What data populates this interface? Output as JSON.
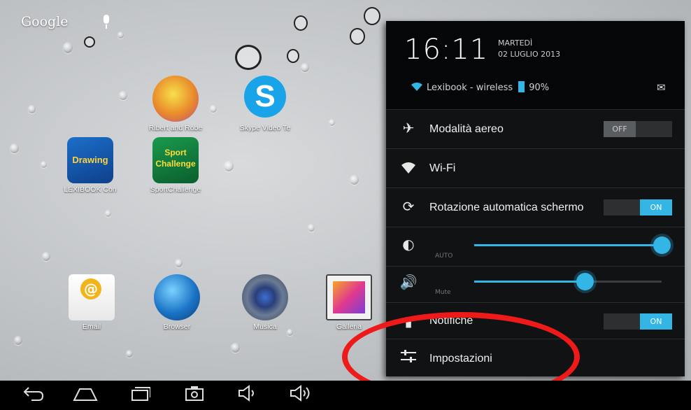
{
  "homescreen": {
    "search_label": "Google",
    "apps": [
      {
        "label": "Ribert and Robe",
        "icon": "robert-game-icon"
      },
      {
        "label": "Skype Video Te",
        "icon": "skype-icon",
        "glyph": "S"
      },
      {
        "label": "LEXIBOOK Con",
        "icon": "drawing-app-icon",
        "glyph": "Drawing"
      },
      {
        "label": "SportChallenge",
        "icon": "sport-challenge-icon",
        "glyph": "Sport Challenge"
      },
      {
        "label": "Email",
        "icon": "email-icon"
      },
      {
        "label": "Browser",
        "icon": "browser-globe-icon"
      },
      {
        "label": "Musica",
        "icon": "speaker-icon"
      },
      {
        "label": "Galleria",
        "icon": "gallery-icon"
      }
    ]
  },
  "navbar": {
    "buttons": [
      "back-icon",
      "home-icon",
      "recent-apps-icon",
      "screenshot-icon",
      "volume-down-icon",
      "volume-up-icon"
    ]
  },
  "panel": {
    "time": "16:11",
    "day": "MARTEDÌ",
    "date": "02 LUGLIO 2013",
    "network": "Lexibook - wireless",
    "battery": "90%",
    "rows": {
      "airplane": {
        "label": "Modalità aereo",
        "toggle": "OFF"
      },
      "wifi": {
        "label": "Wi-Fi"
      },
      "rotation": {
        "label": "Rotazione automatica schermo",
        "toggle": "ON"
      },
      "brightness": {
        "sublabel": "AUTO",
        "level": 1.0
      },
      "volume": {
        "sublabel": "Mute",
        "level": 0.59
      },
      "notifications": {
        "label": "Notifiche",
        "toggle": "ON"
      },
      "settings": {
        "label": "Impostazioni"
      }
    }
  },
  "colors": {
    "accent": "#33b5e5",
    "highlight_ring": "#ee1a1a"
  }
}
